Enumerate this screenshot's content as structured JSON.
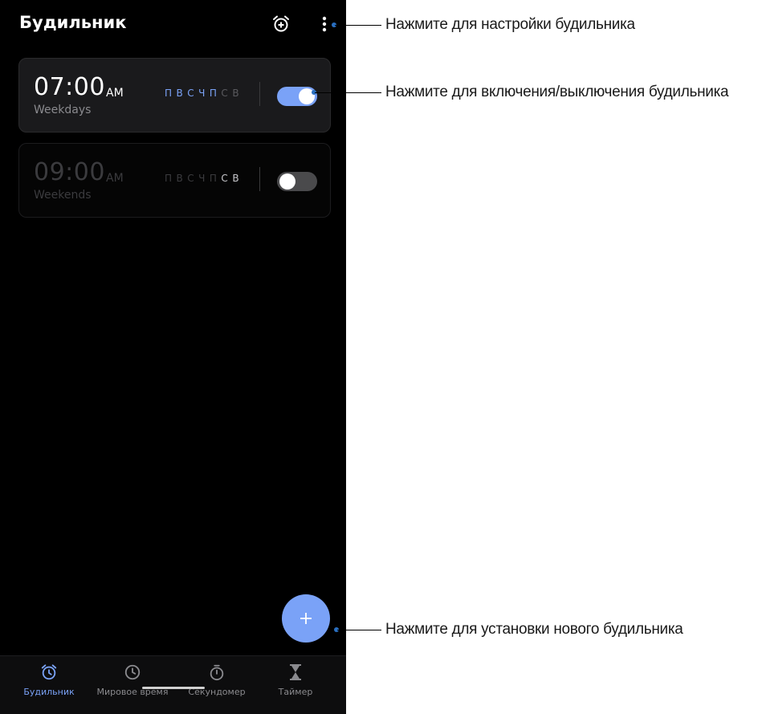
{
  "app": {
    "title": "Будильник"
  },
  "top_actions": {
    "add_alarm_icon": "alarm-add-icon",
    "more_icon": "more-vertical-icon"
  },
  "alarms": [
    {
      "time": "07:00",
      "ampm": "AM",
      "label": "Weekdays",
      "enabled": true,
      "days": [
        {
          "letter": "П",
          "selected": true
        },
        {
          "letter": "В",
          "selected": true
        },
        {
          "letter": "С",
          "selected": true
        },
        {
          "letter": "Ч",
          "selected": true
        },
        {
          "letter": "П",
          "selected": true
        },
        {
          "letter": "С",
          "selected": false
        },
        {
          "letter": "В",
          "selected": false
        }
      ]
    },
    {
      "time": "09:00",
      "ampm": "AM",
      "label": "Weekends",
      "enabled": false,
      "days": [
        {
          "letter": "П",
          "selected": false
        },
        {
          "letter": "В",
          "selected": false
        },
        {
          "letter": "С",
          "selected": false
        },
        {
          "letter": "Ч",
          "selected": false
        },
        {
          "letter": "П",
          "selected": false
        },
        {
          "letter": "С",
          "selected": true
        },
        {
          "letter": "В",
          "selected": true
        }
      ]
    }
  ],
  "fab": {
    "icon": "plus-icon"
  },
  "bottom_nav": [
    {
      "label": "Будильник",
      "icon": "alarm-icon",
      "active": true
    },
    {
      "label": "Мировое время",
      "icon": "clock-icon",
      "active": false
    },
    {
      "label": "Секундомер",
      "icon": "stopwatch-icon",
      "active": false
    },
    {
      "label": "Таймер",
      "icon": "hourglass-icon",
      "active": false
    }
  ],
  "callouts": {
    "settings": "Нажмите для настройки будильника",
    "toggle": "Нажмите для включения/выключения будильника",
    "new_alarm": "Нажмите для установки нового будильника"
  },
  "colors": {
    "accent": "#7aa2f7",
    "background": "#000000",
    "card_active": "#1a1a1c",
    "callout_dot": "#2a6fc0",
    "day_selected_on": "#7aa2f7",
    "day_unselected_on": "#5a5a5e",
    "day_selected_off": "#c8c8cc",
    "day_unselected_off": "#3b3b3e"
  }
}
